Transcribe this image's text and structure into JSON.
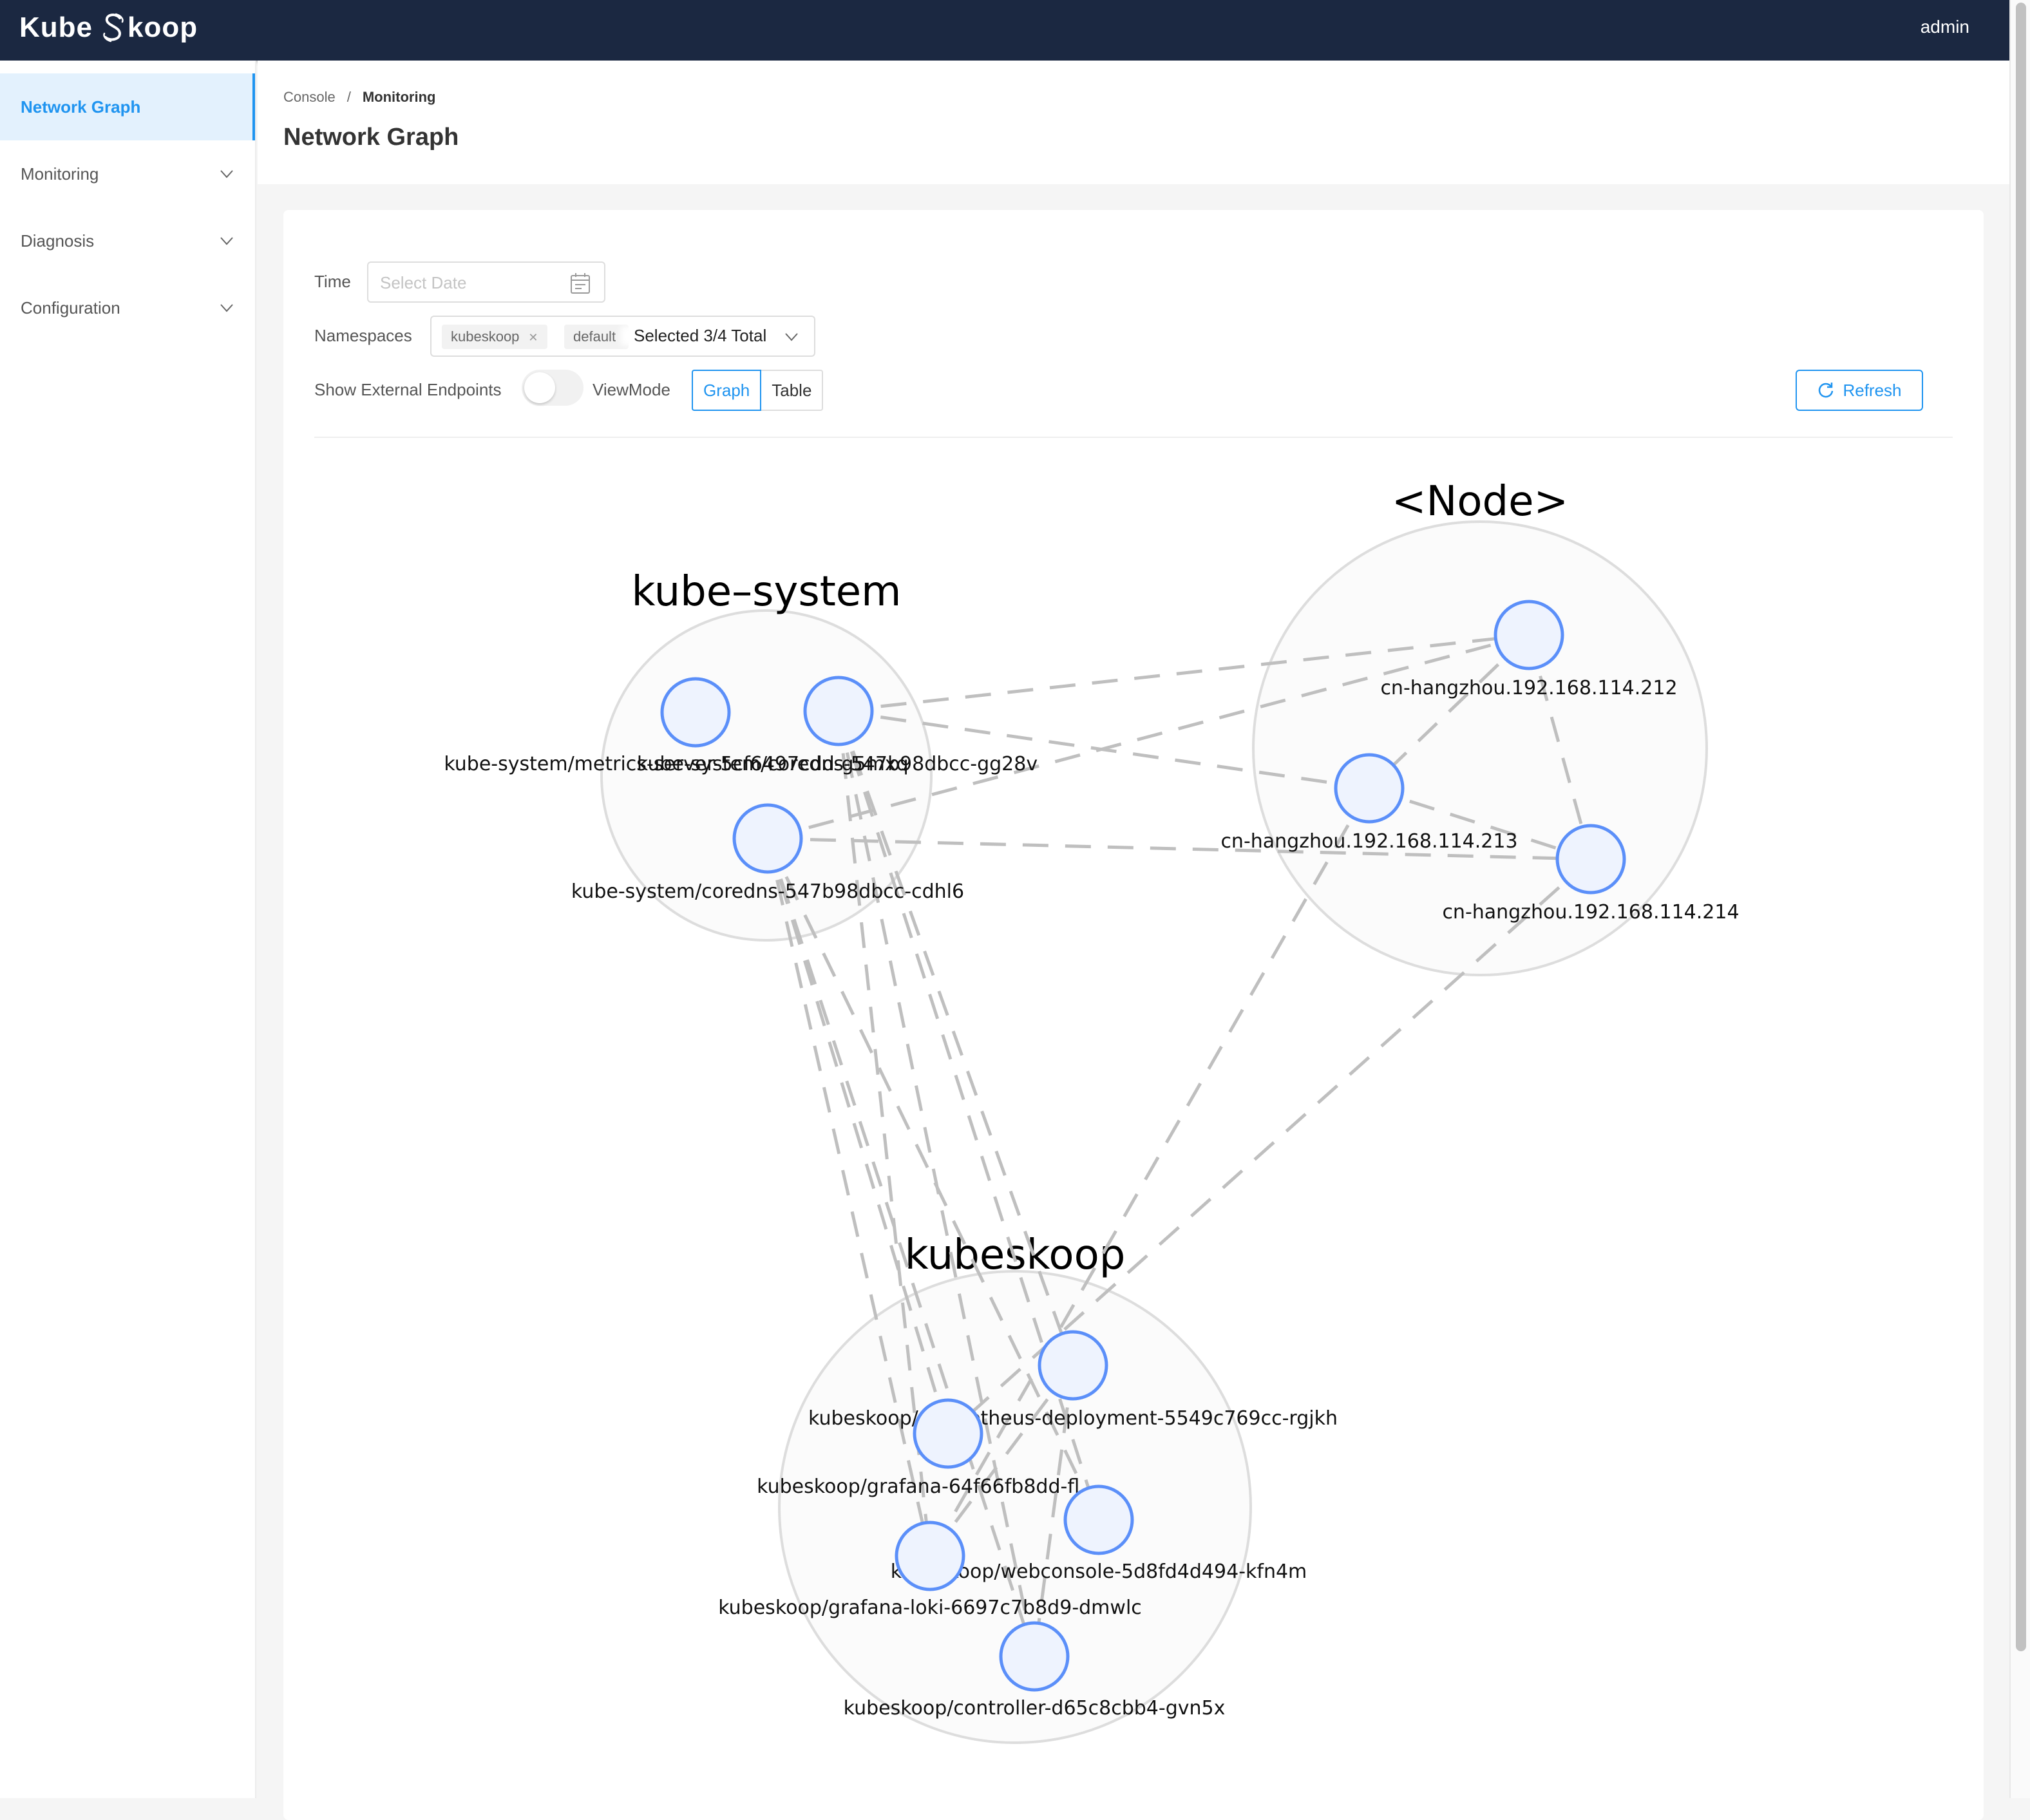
{
  "app": {
    "brand_left": "Kube",
    "brand_right": "koop",
    "user": "admin"
  },
  "sidebar": {
    "items": [
      {
        "label": "Network Graph",
        "active": true,
        "expandable": false
      },
      {
        "label": "Monitoring",
        "active": false,
        "expandable": true
      },
      {
        "label": "Diagnosis",
        "active": false,
        "expandable": true
      },
      {
        "label": "Configuration",
        "active": false,
        "expandable": true
      }
    ]
  },
  "breadcrumb": {
    "items": [
      "Console",
      "Monitoring"
    ],
    "separator": "/"
  },
  "page": {
    "title": "Network Graph"
  },
  "filters": {
    "time_label": "Time",
    "time_placeholder": "Select Date",
    "namespaces_label": "Namespaces",
    "namespace_tags": [
      "kubeskoop",
      "default"
    ],
    "namespace_summary": "Selected 3/4 Total",
    "external_label": "Show External Endpoints",
    "external_enabled": false,
    "viewmode_label": "ViewMode",
    "viewmodes": [
      "Graph",
      "Table"
    ],
    "viewmode_selected": "Graph",
    "refresh_label": "Refresh"
  },
  "colors": {
    "accent": "#1f94f0",
    "topbar": "#1b2841",
    "node_stroke": "#5b8ff9",
    "node_fill": "#eef3fe",
    "edge": "#bfbfbf",
    "group_stroke": "#dddddd"
  },
  "graph": {
    "groups": [
      {
        "id": "kube-system",
        "label": "kube–system"
      },
      {
        "id": "node",
        "label": "<Node>"
      },
      {
        "id": "kubeskoop",
        "label": "kubeskoop"
      }
    ],
    "nodes": [
      {
        "id": "metrics",
        "group": "kube-system",
        "label": "kube-system/metrics-server-5cf6497cdd-g5mxq"
      },
      {
        "id": "coredns1",
        "group": "kube-system",
        "label": "kube-system/coredns-547b98dbcc-gg28v"
      },
      {
        "id": "coredns2",
        "group": "kube-system",
        "label": "kube-system/coredns-547b98dbcc-cdhl6"
      },
      {
        "id": "n212",
        "group": "node",
        "label": "cn-hangzhou.192.168.114.212"
      },
      {
        "id": "n213",
        "group": "node",
        "label": "cn-hangzhou.192.168.114.213"
      },
      {
        "id": "n214",
        "group": "node",
        "label": "cn-hangzhou.192.168.114.214"
      },
      {
        "id": "prometheus",
        "group": "kubeskoop",
        "label": "kubeskoop/prometheus-deployment-5549c769cc-rgjkh"
      },
      {
        "id": "grafana",
        "group": "kubeskoop",
        "label": "kubeskoop/grafana-64f66fb8dd-fl..."
      },
      {
        "id": "webconsole",
        "group": "kubeskoop",
        "label": "kubeskoop/webconsole-5d8fd4d494-kfn4m"
      },
      {
        "id": "loki",
        "group": "kubeskoop",
        "label": "kubeskoop/grafana-loki-6697c7b8d9-dmwlc"
      },
      {
        "id": "controller",
        "group": "kubeskoop",
        "label": "kubeskoop/controller-d65c8cbb4-gvn5x"
      }
    ],
    "edges": [
      [
        "coredns1",
        "n212"
      ],
      [
        "coredns1",
        "n213"
      ],
      [
        "coredns2",
        "n212"
      ],
      [
        "coredns2",
        "n214"
      ],
      [
        "n212",
        "n213"
      ],
      [
        "n212",
        "n214"
      ],
      [
        "n213",
        "n214"
      ],
      [
        "coredns2",
        "grafana"
      ],
      [
        "coredns2",
        "loki"
      ],
      [
        "coredns2",
        "controller"
      ],
      [
        "coredns1",
        "prometheus"
      ],
      [
        "coredns1",
        "webconsole"
      ],
      [
        "coredns1",
        "controller"
      ],
      [
        "coredns2",
        "webconsole"
      ],
      [
        "coredns1",
        "loki"
      ],
      [
        "n213",
        "loki"
      ],
      [
        "n214",
        "grafana"
      ],
      [
        "prometheus",
        "loki"
      ],
      [
        "prometheus",
        "controller"
      ]
    ]
  }
}
